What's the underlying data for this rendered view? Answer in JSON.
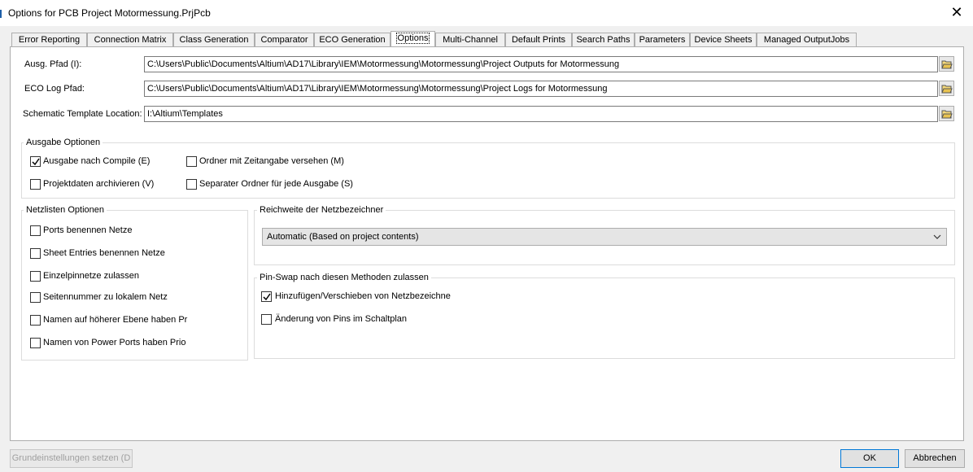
{
  "window": {
    "title": "Options for PCB Project Motormessung.PrjPcb",
    "close_glyph": "✕"
  },
  "tabs": [
    {
      "label": "Error Reporting"
    },
    {
      "label": "Connection Matrix"
    },
    {
      "label": "Class Generation"
    },
    {
      "label": "Comparator"
    },
    {
      "label": "ECO Generation"
    },
    {
      "label": "Options",
      "active": true
    },
    {
      "label": "Multi-Channel"
    },
    {
      "label": "Default Prints"
    },
    {
      "label": "Search Paths"
    },
    {
      "label": "Parameters"
    },
    {
      "label": "Device Sheets"
    },
    {
      "label": "Managed OutputJobs"
    }
  ],
  "paths": {
    "output": {
      "label": "Ausg. Pfad (I):",
      "value": "C:\\Users\\Public\\Documents\\Altium\\AD17\\Library\\IEM\\Motormessung\\Motormessung\\Project Outputs for Motormessung"
    },
    "eco_log": {
      "label": "ECO Log Pfad:",
      "value": "C:\\Users\\Public\\Documents\\Altium\\AD17\\Library\\IEM\\Motormessung\\Motormessung\\Project Logs for Motormessung"
    },
    "template": {
      "label": "Schematic Template Location:",
      "value": "I:\\Altium\\Templates"
    }
  },
  "output_options": {
    "title": "Ausgabe Optionen",
    "items": [
      {
        "label": "Ausgabe nach Compile (E)",
        "checked": true
      },
      {
        "label": "Ordner mit Zeitangabe versehen (M)",
        "checked": false
      },
      {
        "label": "Projektdaten archivieren (V)",
        "checked": false
      },
      {
        "label": "Separater Ordner für jede Ausgabe (S)",
        "checked": false
      }
    ]
  },
  "netlist_options": {
    "title": "Netzlisten Optionen",
    "items": [
      {
        "label": "Ports benennen Netze",
        "checked": false
      },
      {
        "label": "Sheet Entries benennen Netze",
        "checked": false
      },
      {
        "label": "Einzelpinnetze zulassen",
        "checked": false
      },
      {
        "label": "Seitennummer zu lokalem Netz",
        "checked": false
      },
      {
        "label": "Namen auf höherer Ebene haben Pr",
        "checked": false
      },
      {
        "label": "Namen von Power Ports haben Prio",
        "checked": false
      }
    ]
  },
  "scope": {
    "title": "Reichweite der Netzbezeichner",
    "selected": "Automatic (Based on project contents)"
  },
  "pinswap": {
    "title": "Pin-Swap nach diesen Methoden zulassen",
    "items": [
      {
        "label": "Hinzufügen/Verschieben von Netzbezeichne",
        "checked": true
      },
      {
        "label": "Änderung von Pins im Schaltplan",
        "checked": false
      }
    ]
  },
  "buttons": {
    "defaults": "Grundeinstellungen setzen (D",
    "ok": "OK",
    "cancel": "Abbrechen"
  },
  "colors": {
    "accent": "#0078d7",
    "panel": "#ffffff",
    "background": "#f0f0f0"
  }
}
